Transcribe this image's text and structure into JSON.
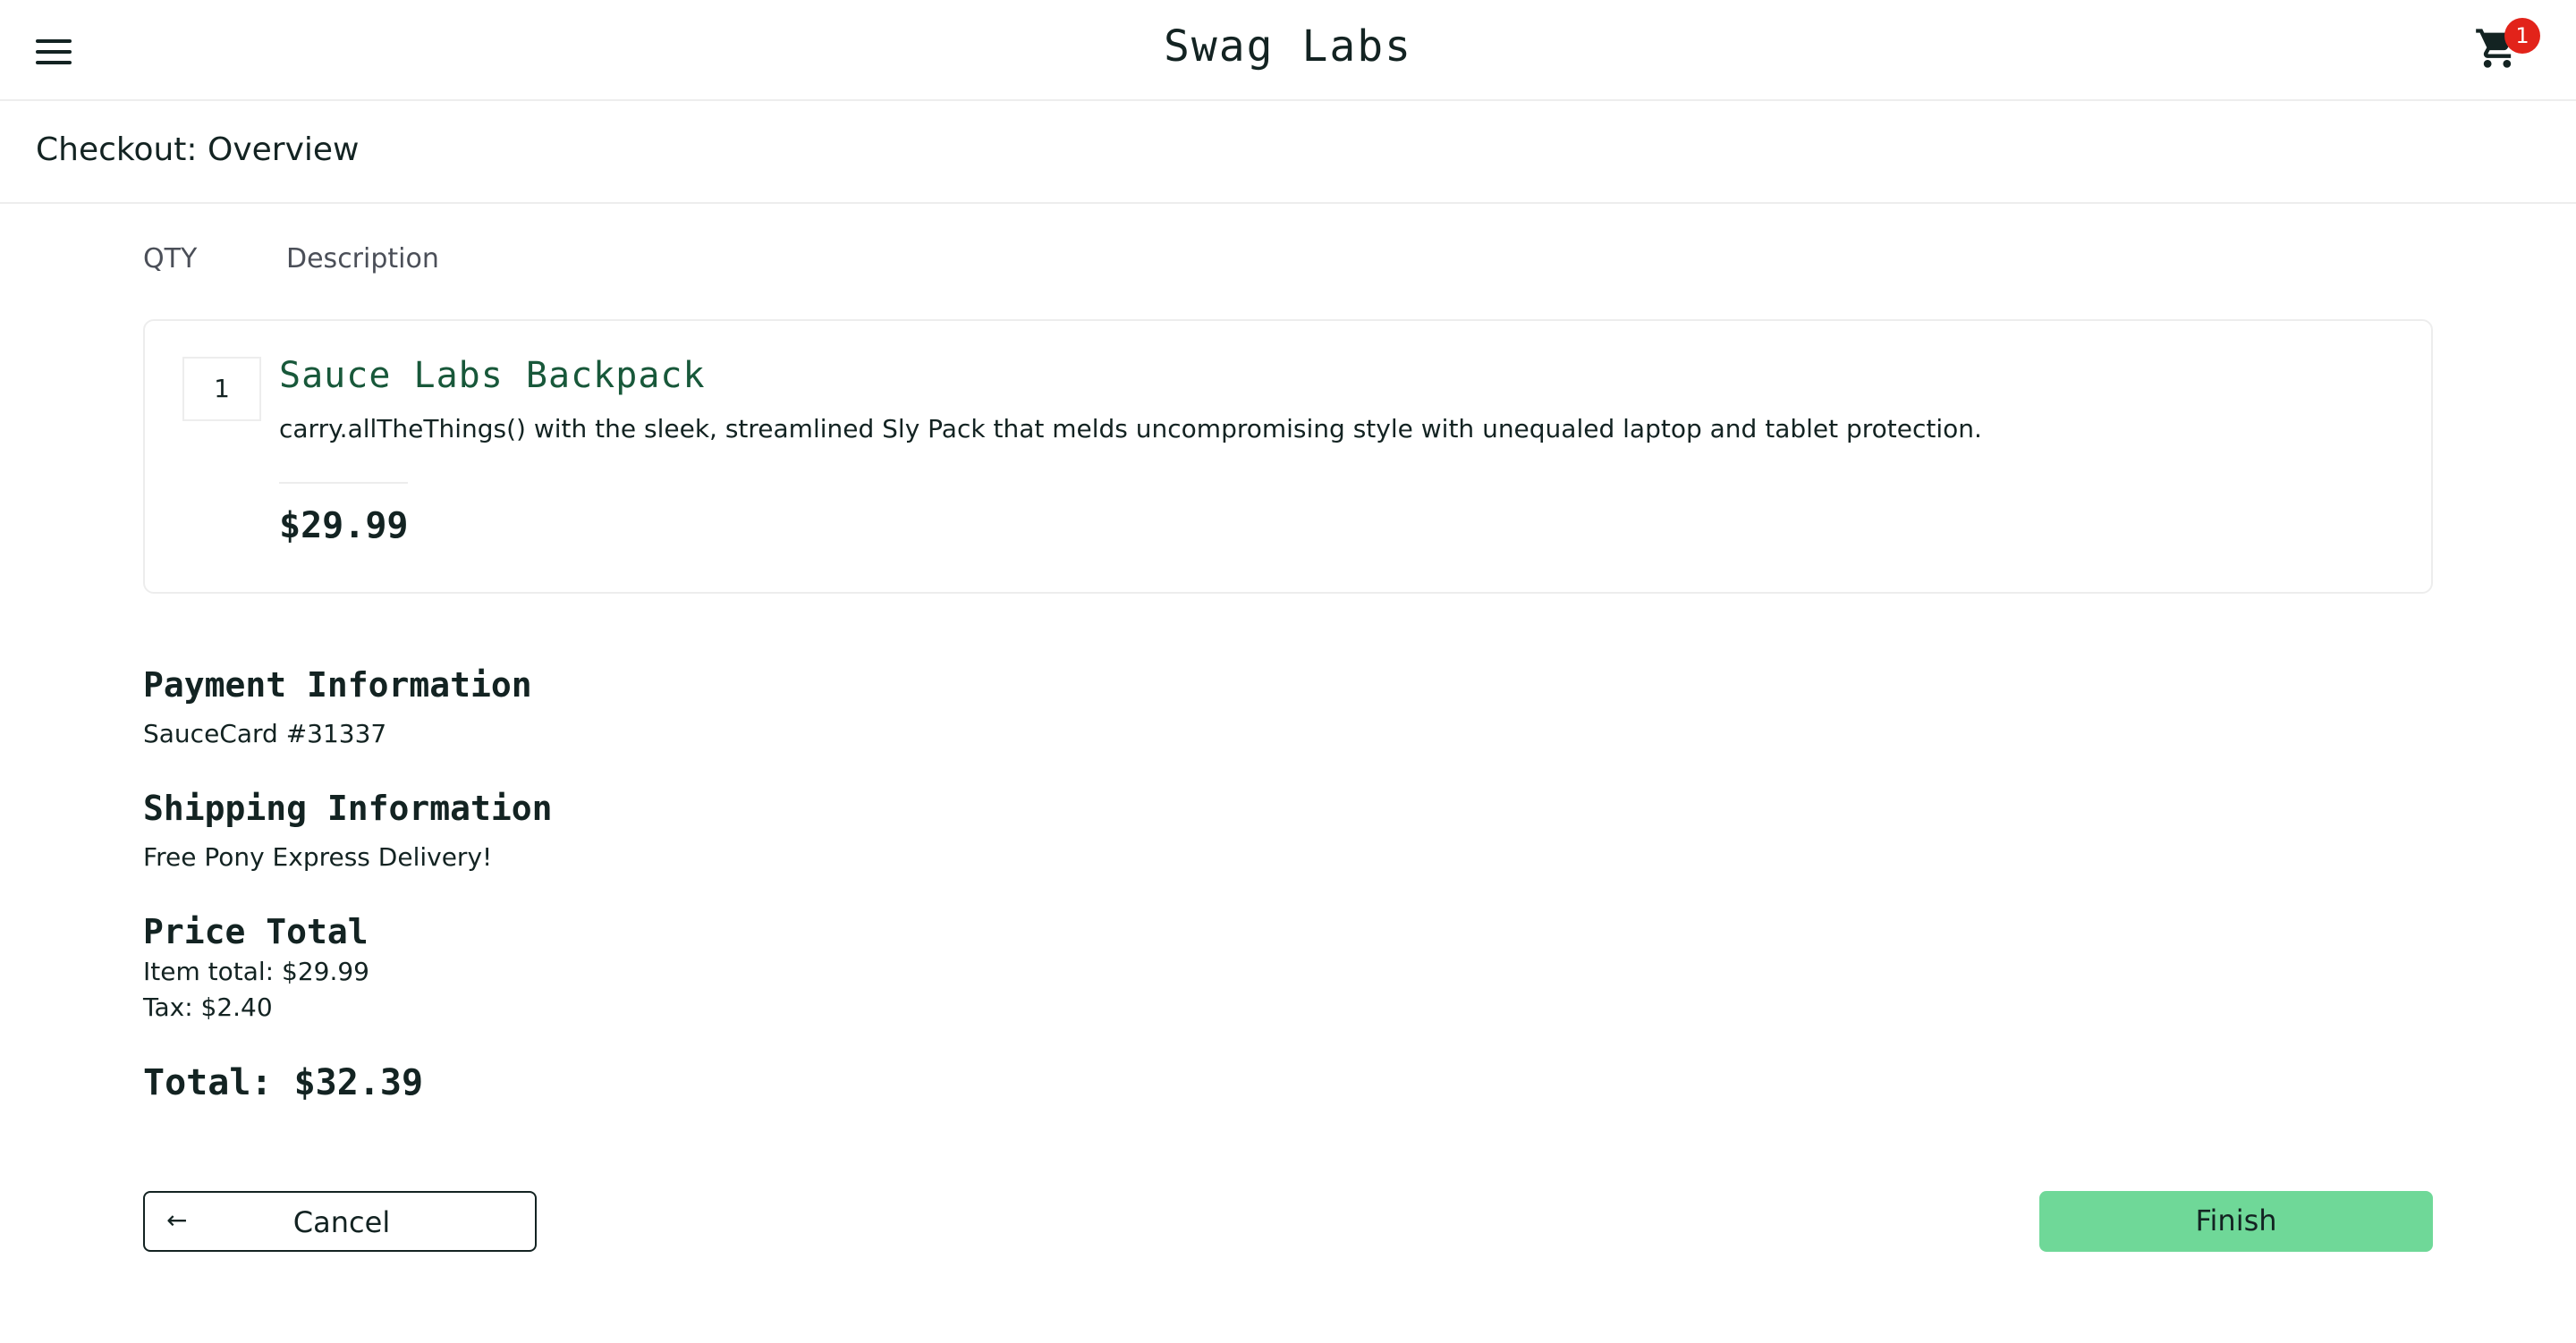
{
  "header": {
    "app_title": "Swag Labs",
    "cart_count": "1"
  },
  "page": {
    "title": "Checkout: Overview"
  },
  "columns": {
    "qty": "QTY",
    "description": "Description"
  },
  "items": [
    {
      "qty": "1",
      "name": "Sauce Labs Backpack",
      "description": "carry.allTheThings() with the sleek, streamlined Sly Pack that melds uncompromising style with unequaled laptop and tablet protection.",
      "price": "$29.99"
    }
  ],
  "summary": {
    "payment_label": "Payment Information",
    "payment_value": "SauceCard #31337",
    "shipping_label": "Shipping Information",
    "shipping_value": "Free Pony Express Delivery!",
    "price_label": "Price Total",
    "item_total": "Item total: $29.99",
    "tax": "Tax: $2.40",
    "total": "Total: $32.39"
  },
  "actions": {
    "cancel_label": "Cancel",
    "finish_label": "Finish"
  },
  "colors": {
    "accent_green": "#6fd898",
    "item_name_green": "#18583a",
    "badge_red": "#e2231a"
  }
}
